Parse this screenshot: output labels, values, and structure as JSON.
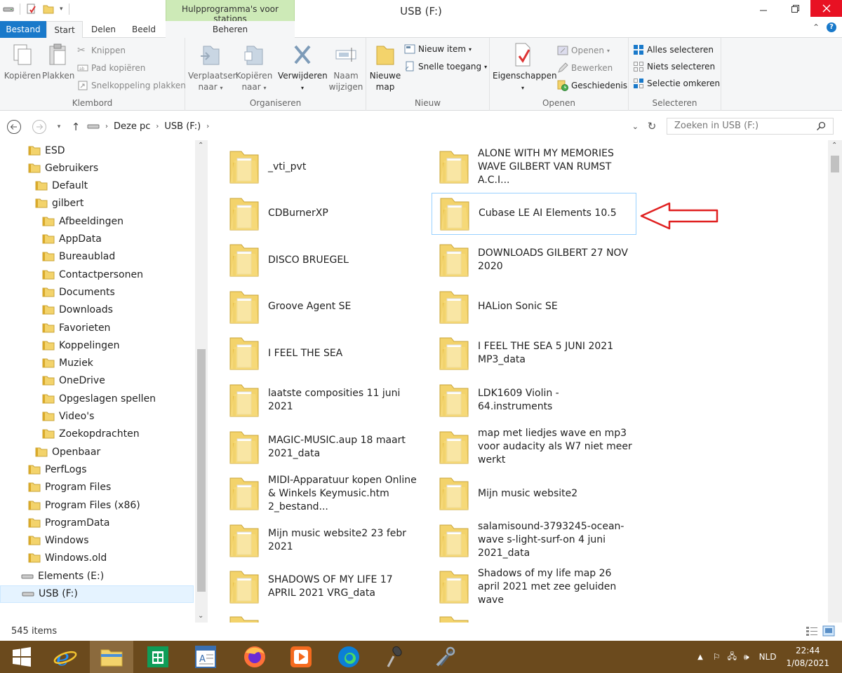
{
  "window": {
    "title": "USB (F:)",
    "context_tab_title": "Hulpprogramma's voor stations"
  },
  "tabs": [
    {
      "label": "Bestand"
    },
    {
      "label": "Start"
    },
    {
      "label": "Delen"
    },
    {
      "label": "Beeld"
    },
    {
      "label": "Beheren"
    }
  ],
  "ribbon": {
    "klembord": {
      "label": "Klembord",
      "copy": "Kopiëren",
      "paste": "Plakken",
      "cut": "Knippen",
      "copy_path": "Pad kopiëren",
      "paste_shortcut": "Snelkoppeling plakken"
    },
    "organiseren": {
      "label": "Organiseren",
      "move_to_1": "Verplaatsen",
      "move_to_2": "naar",
      "copy_to_1": "Kopiëren",
      "copy_to_2": "naar",
      "delete": "Verwijderen",
      "rename_1": "Naam",
      "rename_2": "wijzigen"
    },
    "nieuw": {
      "label": "Nieuw",
      "new_folder_1": "Nieuwe",
      "new_folder_2": "map",
      "new_item": "Nieuw item",
      "easy_access": "Snelle toegang"
    },
    "openen": {
      "label": "Openen",
      "properties": "Eigenschappen",
      "open": "Openen",
      "edit": "Bewerken",
      "history": "Geschiedenis"
    },
    "selecteren": {
      "label": "Selecteren",
      "select_all": "Alles selecteren",
      "select_none": "Niets selecteren",
      "invert": "Selectie omkeren"
    }
  },
  "address": {
    "parts": [
      "Deze pc",
      "USB (F:)"
    ],
    "search_placeholder": "Zoeken in USB (F:)"
  },
  "nav": [
    {
      "label": "ESD",
      "indent": 1
    },
    {
      "label": "Gebruikers",
      "indent": 1
    },
    {
      "label": "Default",
      "indent": 2
    },
    {
      "label": "gilbert",
      "indent": 2
    },
    {
      "label": "Afbeeldingen",
      "indent": 3
    },
    {
      "label": "AppData",
      "indent": 3
    },
    {
      "label": "Bureaublad",
      "indent": 3
    },
    {
      "label": "Contactpersonen",
      "indent": 3
    },
    {
      "label": "Documents",
      "indent": 3
    },
    {
      "label": "Downloads",
      "indent": 3
    },
    {
      "label": "Favorieten",
      "indent": 3
    },
    {
      "label": "Koppelingen",
      "indent": 3
    },
    {
      "label": "Muziek",
      "indent": 3
    },
    {
      "label": "OneDrive",
      "indent": 3
    },
    {
      "label": "Opgeslagen spellen",
      "indent": 3
    },
    {
      "label": "Video's",
      "indent": 3
    },
    {
      "label": "Zoekopdrachten",
      "indent": 3
    },
    {
      "label": "Openbaar",
      "indent": 2
    },
    {
      "label": "PerfLogs",
      "indent": 1
    },
    {
      "label": "Program Files",
      "indent": 1
    },
    {
      "label": "Program Files (x86)",
      "indent": 1
    },
    {
      "label": "ProgramData",
      "indent": 1
    },
    {
      "label": "Windows",
      "indent": 1
    },
    {
      "label": "Windows.old",
      "indent": 1
    },
    {
      "label": "Elements (E:)",
      "indent": 0,
      "drive": true
    },
    {
      "label": "USB (F:)",
      "indent": 0,
      "drive": true,
      "selected": true
    }
  ],
  "files": [
    {
      "name": "_vti_pvt"
    },
    {
      "name": "ALONE WITH MY MEMORIES WAVE GILBERT VAN RUMST A.C.I..."
    },
    {
      "name": "CDBurnerXP"
    },
    {
      "name": "Cubase LE AI Elements 10.5",
      "selected": true
    },
    {
      "name": "DISCO BRUEGEL"
    },
    {
      "name": "DOWNLOADS   GILBERT  27 NOV 2020"
    },
    {
      "name": "Groove Agent SE"
    },
    {
      "name": "HALion Sonic SE"
    },
    {
      "name": "I FEEL THE SEA"
    },
    {
      "name": "I FEEL THE SEA 5 JUNI 2021 MP3_data"
    },
    {
      "name": "laatste composities 11 juni 2021"
    },
    {
      "name": "LDK1609 Violin - 64.instruments"
    },
    {
      "name": "MAGIC-MUSIC.aup  18 maart 2021_data"
    },
    {
      "name": "map met liedjes wave en mp3 voor audacity als W7 niet meer werkt"
    },
    {
      "name": "MIDI-Apparatuur kopen Online & Winkels  Keymusic.htm 2_bestand..."
    },
    {
      "name": "Mijn music website2"
    },
    {
      "name": "Mijn music website2 23 febr 2021"
    },
    {
      "name": "salamisound-3793245-ocean-wave s-light-surf-on 4 juni 2021_data"
    },
    {
      "name": "SHADOWS OF MY LIFE 17 APRIL 2021  VRG_data"
    },
    {
      "name": "Shadows of my life map 26 april 2021 met  zee geluiden wave"
    }
  ],
  "status": {
    "item_count": "545 items"
  },
  "tray": {
    "language": "NLD",
    "time": "22:44",
    "date": "1/08/2021"
  },
  "colors": {
    "file_tab": "#1979ca",
    "context_tab": "#cdeab7",
    "taskbar": "#6b4a1d",
    "close_button": "#e81123",
    "annotation_arrow": "#e02020"
  }
}
